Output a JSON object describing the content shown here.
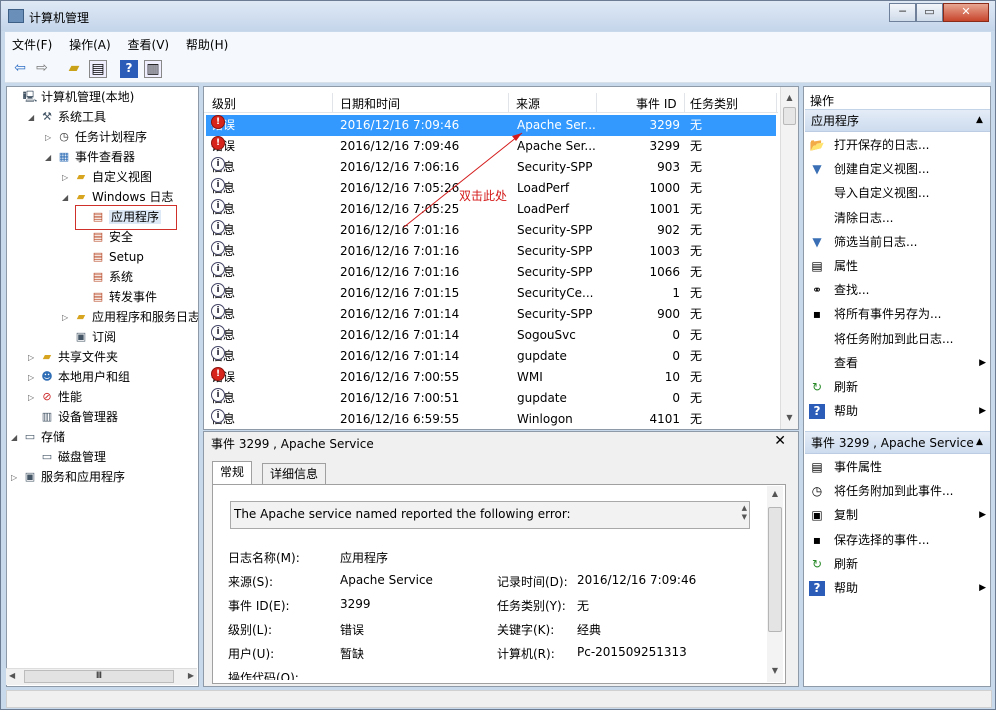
{
  "window": {
    "title": "计算机管理",
    "min": "─",
    "max": "▭",
    "close": "✕"
  },
  "menu": [
    "文件(F)",
    "操作(A)",
    "查看(V)",
    "帮助(H)"
  ],
  "toolbar_icons": [
    "back-arrow-icon",
    "forward-arrow-icon",
    "up-folder-icon",
    "show-hide-tree-icon",
    "help-icon",
    "show-action-pane-icon"
  ],
  "tree": [
    {
      "label": "计算机管理(本地)",
      "icon": "computer-mgmt-icon",
      "exp": ""
    },
    {
      "label": "系统工具",
      "icon": "system-tools-icon",
      "exp": "◢"
    },
    {
      "label": "任务计划程序",
      "icon": "task-scheduler-icon",
      "exp": "▷"
    },
    {
      "label": "事件查看器",
      "icon": "event-viewer-icon",
      "exp": "◢"
    },
    {
      "label": "自定义视图",
      "icon": "custom-views-folder-icon",
      "exp": "▷"
    },
    {
      "label": "Windows 日志",
      "icon": "windows-logs-folder-icon",
      "exp": "◢"
    },
    {
      "label": "应用程序",
      "icon": "log-icon",
      "exp": ""
    },
    {
      "label": "安全",
      "icon": "log-icon",
      "exp": ""
    },
    {
      "label": "Setup",
      "icon": "log-icon",
      "exp": ""
    },
    {
      "label": "系统",
      "icon": "log-icon",
      "exp": ""
    },
    {
      "label": "转发事件",
      "icon": "log-icon",
      "exp": ""
    },
    {
      "label": "应用程序和服务日志",
      "icon": "folder-icon",
      "exp": "▷"
    },
    {
      "label": "订阅",
      "icon": "subscriptions-icon",
      "exp": ""
    },
    {
      "label": "共享文件夹",
      "icon": "shared-folders-icon",
      "exp": "▷"
    },
    {
      "label": "本地用户和组",
      "icon": "users-groups-icon",
      "exp": "▷"
    },
    {
      "label": "性能",
      "icon": "performance-icon",
      "exp": "▷"
    },
    {
      "label": "设备管理器",
      "icon": "device-manager-icon",
      "exp": ""
    },
    {
      "label": "存储",
      "icon": "storage-icon",
      "exp": "◢"
    },
    {
      "label": "磁盘管理",
      "icon": "disk-management-icon",
      "exp": ""
    },
    {
      "label": "服务和应用程序",
      "icon": "services-apps-icon",
      "exp": "▷"
    }
  ],
  "tree_hscroll_thumb": "Ⅲ",
  "columns": [
    "级别",
    "日期和时间",
    "来源",
    "事件 ID",
    "任务类别"
  ],
  "events": [
    {
      "level": "错误",
      "type": "error",
      "datetime": "2016/12/16 7:09:46",
      "source": "Apache Ser...",
      "id": "3299",
      "category": "无"
    },
    {
      "level": "错误",
      "type": "error",
      "datetime": "2016/12/16 7:09:46",
      "source": "Apache Ser...",
      "id": "3299",
      "category": "无"
    },
    {
      "level": "信息",
      "type": "info",
      "datetime": "2016/12/16 7:06:16",
      "source": "Security-SPP",
      "id": "903",
      "category": "无"
    },
    {
      "level": "信息",
      "type": "info",
      "datetime": "2016/12/16 7:05:26",
      "source": "LoadPerf",
      "id": "1000",
      "category": "无"
    },
    {
      "level": "信息",
      "type": "info",
      "datetime": "2016/12/16 7:05:25",
      "source": "LoadPerf",
      "id": "1001",
      "category": "无"
    },
    {
      "level": "信息",
      "type": "info",
      "datetime": "2016/12/16 7:01:16",
      "source": "Security-SPP",
      "id": "902",
      "category": "无"
    },
    {
      "level": "信息",
      "type": "info",
      "datetime": "2016/12/16 7:01:16",
      "source": "Security-SPP",
      "id": "1003",
      "category": "无"
    },
    {
      "level": "信息",
      "type": "info",
      "datetime": "2016/12/16 7:01:16",
      "source": "Security-SPP",
      "id": "1066",
      "category": "无"
    },
    {
      "level": "信息",
      "type": "info",
      "datetime": "2016/12/16 7:01:15",
      "source": "SecurityCe...",
      "id": "1",
      "category": "无"
    },
    {
      "level": "信息",
      "type": "info",
      "datetime": "2016/12/16 7:01:14",
      "source": "Security-SPP",
      "id": "900",
      "category": "无"
    },
    {
      "level": "信息",
      "type": "info",
      "datetime": "2016/12/16 7:01:14",
      "source": "SogouSvc",
      "id": "0",
      "category": "无"
    },
    {
      "level": "信息",
      "type": "info",
      "datetime": "2016/12/16 7:01:14",
      "source": "gupdate",
      "id": "0",
      "category": "无"
    },
    {
      "level": "错误",
      "type": "error",
      "datetime": "2016/12/16 7:00:55",
      "source": "WMI",
      "id": "10",
      "category": "无"
    },
    {
      "level": "信息",
      "type": "info",
      "datetime": "2016/12/16 7:00:51",
      "source": "gupdate",
      "id": "0",
      "category": "无"
    },
    {
      "level": "信息",
      "type": "info",
      "datetime": "2016/12/16 6:59:55",
      "source": "Winlogon",
      "id": "4101",
      "category": "无"
    }
  ],
  "annotation": "双击此处",
  "detail": {
    "title": "事件 3299 , Apache Service",
    "tabs": [
      "常规",
      "详细信息"
    ],
    "description": "The Apache service named  reported the following error:",
    "left_fields": [
      {
        "label": "日志名称(M):",
        "value": "应用程序"
      },
      {
        "label": "来源(S):",
        "value": "Apache Service"
      },
      {
        "label": "事件 ID(E):",
        "value": "3299"
      },
      {
        "label": "级别(L):",
        "value": "错误"
      },
      {
        "label": "用户(U):",
        "value": "暂缺"
      }
    ],
    "right_fields": [
      {
        "label": "记录时间(D):",
        "value": "2016/12/16 7:09:46"
      },
      {
        "label": "任务类别(Y):",
        "value": "无"
      },
      {
        "label": "关键字(K):",
        "value": "经典"
      },
      {
        "label": "计算机(R):",
        "value": "Pc-201509251313"
      }
    ],
    "cut_label": "操作代码(O):"
  },
  "actions": {
    "header": "操作",
    "section1": "应用程序",
    "items1": [
      {
        "label": "打开保存的日志...",
        "icon": "open-log-icon",
        "more": false
      },
      {
        "label": "创建自定义视图...",
        "icon": "create-view-filter-icon",
        "more": false
      },
      {
        "label": "导入自定义视图...",
        "icon": "",
        "more": false
      },
      {
        "label": "清除日志...",
        "icon": "",
        "more": false
      },
      {
        "label": "筛选当前日志...",
        "icon": "filter-icon",
        "more": false
      },
      {
        "label": "属性",
        "icon": "properties-icon",
        "more": false
      },
      {
        "label": "查找...",
        "icon": "find-binoculars-icon",
        "more": false
      },
      {
        "label": "将所有事件另存为...",
        "icon": "save-icon",
        "more": false
      },
      {
        "label": "将任务附加到此日志...",
        "icon": "",
        "more": false
      },
      {
        "label": "查看",
        "icon": "",
        "more": true
      },
      {
        "label": "刷新",
        "icon": "refresh-icon",
        "more": false
      },
      {
        "label": "帮助",
        "icon": "help-icon",
        "more": true
      }
    ],
    "section2": "事件 3299 , Apache Service",
    "items2": [
      {
        "label": "事件属性",
        "icon": "event-properties-icon",
        "more": false
      },
      {
        "label": "将任务附加到此事件...",
        "icon": "attach-task-icon",
        "more": false
      },
      {
        "label": "复制",
        "icon": "copy-icon",
        "more": true
      },
      {
        "label": "保存选择的事件...",
        "icon": "save-icon",
        "more": false
      },
      {
        "label": "刷新",
        "icon": "refresh-icon",
        "more": false
      },
      {
        "label": "帮助",
        "icon": "help-icon",
        "more": true
      }
    ]
  }
}
